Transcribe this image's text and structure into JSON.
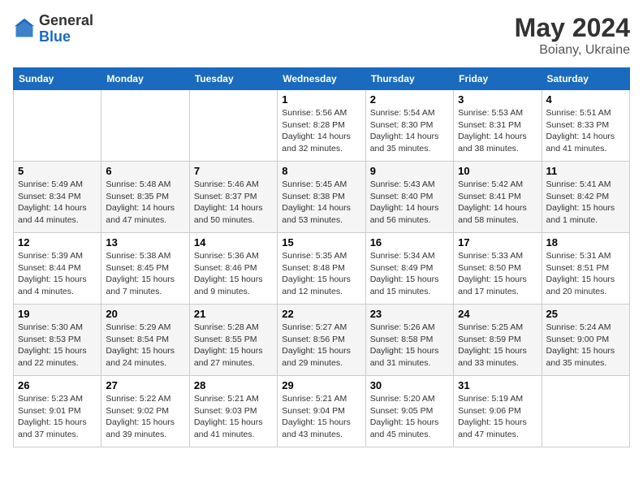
{
  "header": {
    "logo_general": "General",
    "logo_blue": "Blue",
    "month_year": "May 2024",
    "location": "Boiany, Ukraine"
  },
  "weekdays": [
    "Sunday",
    "Monday",
    "Tuesday",
    "Wednesday",
    "Thursday",
    "Friday",
    "Saturday"
  ],
  "weeks": [
    [
      {
        "day": "",
        "info": ""
      },
      {
        "day": "",
        "info": ""
      },
      {
        "day": "",
        "info": ""
      },
      {
        "day": "1",
        "info": "Sunrise: 5:56 AM\nSunset: 8:28 PM\nDaylight: 14 hours\nand 32 minutes."
      },
      {
        "day": "2",
        "info": "Sunrise: 5:54 AM\nSunset: 8:30 PM\nDaylight: 14 hours\nand 35 minutes."
      },
      {
        "day": "3",
        "info": "Sunrise: 5:53 AM\nSunset: 8:31 PM\nDaylight: 14 hours\nand 38 minutes."
      },
      {
        "day": "4",
        "info": "Sunrise: 5:51 AM\nSunset: 8:33 PM\nDaylight: 14 hours\nand 41 minutes."
      }
    ],
    [
      {
        "day": "5",
        "info": "Sunrise: 5:49 AM\nSunset: 8:34 PM\nDaylight: 14 hours\nand 44 minutes."
      },
      {
        "day": "6",
        "info": "Sunrise: 5:48 AM\nSunset: 8:35 PM\nDaylight: 14 hours\nand 47 minutes."
      },
      {
        "day": "7",
        "info": "Sunrise: 5:46 AM\nSunset: 8:37 PM\nDaylight: 14 hours\nand 50 minutes."
      },
      {
        "day": "8",
        "info": "Sunrise: 5:45 AM\nSunset: 8:38 PM\nDaylight: 14 hours\nand 53 minutes."
      },
      {
        "day": "9",
        "info": "Sunrise: 5:43 AM\nSunset: 8:40 PM\nDaylight: 14 hours\nand 56 minutes."
      },
      {
        "day": "10",
        "info": "Sunrise: 5:42 AM\nSunset: 8:41 PM\nDaylight: 14 hours\nand 58 minutes."
      },
      {
        "day": "11",
        "info": "Sunrise: 5:41 AM\nSunset: 8:42 PM\nDaylight: 15 hours\nand 1 minute."
      }
    ],
    [
      {
        "day": "12",
        "info": "Sunrise: 5:39 AM\nSunset: 8:44 PM\nDaylight: 15 hours\nand 4 minutes."
      },
      {
        "day": "13",
        "info": "Sunrise: 5:38 AM\nSunset: 8:45 PM\nDaylight: 15 hours\nand 7 minutes."
      },
      {
        "day": "14",
        "info": "Sunrise: 5:36 AM\nSunset: 8:46 PM\nDaylight: 15 hours\nand 9 minutes."
      },
      {
        "day": "15",
        "info": "Sunrise: 5:35 AM\nSunset: 8:48 PM\nDaylight: 15 hours\nand 12 minutes."
      },
      {
        "day": "16",
        "info": "Sunrise: 5:34 AM\nSunset: 8:49 PM\nDaylight: 15 hours\nand 15 minutes."
      },
      {
        "day": "17",
        "info": "Sunrise: 5:33 AM\nSunset: 8:50 PM\nDaylight: 15 hours\nand 17 minutes."
      },
      {
        "day": "18",
        "info": "Sunrise: 5:31 AM\nSunset: 8:51 PM\nDaylight: 15 hours\nand 20 minutes."
      }
    ],
    [
      {
        "day": "19",
        "info": "Sunrise: 5:30 AM\nSunset: 8:53 PM\nDaylight: 15 hours\nand 22 minutes."
      },
      {
        "day": "20",
        "info": "Sunrise: 5:29 AM\nSunset: 8:54 PM\nDaylight: 15 hours\nand 24 minutes."
      },
      {
        "day": "21",
        "info": "Sunrise: 5:28 AM\nSunset: 8:55 PM\nDaylight: 15 hours\nand 27 minutes."
      },
      {
        "day": "22",
        "info": "Sunrise: 5:27 AM\nSunset: 8:56 PM\nDaylight: 15 hours\nand 29 minutes."
      },
      {
        "day": "23",
        "info": "Sunrise: 5:26 AM\nSunset: 8:58 PM\nDaylight: 15 hours\nand 31 minutes."
      },
      {
        "day": "24",
        "info": "Sunrise: 5:25 AM\nSunset: 8:59 PM\nDaylight: 15 hours\nand 33 minutes."
      },
      {
        "day": "25",
        "info": "Sunrise: 5:24 AM\nSunset: 9:00 PM\nDaylight: 15 hours\nand 35 minutes."
      }
    ],
    [
      {
        "day": "26",
        "info": "Sunrise: 5:23 AM\nSunset: 9:01 PM\nDaylight: 15 hours\nand 37 minutes."
      },
      {
        "day": "27",
        "info": "Sunrise: 5:22 AM\nSunset: 9:02 PM\nDaylight: 15 hours\nand 39 minutes."
      },
      {
        "day": "28",
        "info": "Sunrise: 5:21 AM\nSunset: 9:03 PM\nDaylight: 15 hours\nand 41 minutes."
      },
      {
        "day": "29",
        "info": "Sunrise: 5:21 AM\nSunset: 9:04 PM\nDaylight: 15 hours\nand 43 minutes."
      },
      {
        "day": "30",
        "info": "Sunrise: 5:20 AM\nSunset: 9:05 PM\nDaylight: 15 hours\nand 45 minutes."
      },
      {
        "day": "31",
        "info": "Sunrise: 5:19 AM\nSunset: 9:06 PM\nDaylight: 15 hours\nand 47 minutes."
      },
      {
        "day": "",
        "info": ""
      }
    ]
  ]
}
